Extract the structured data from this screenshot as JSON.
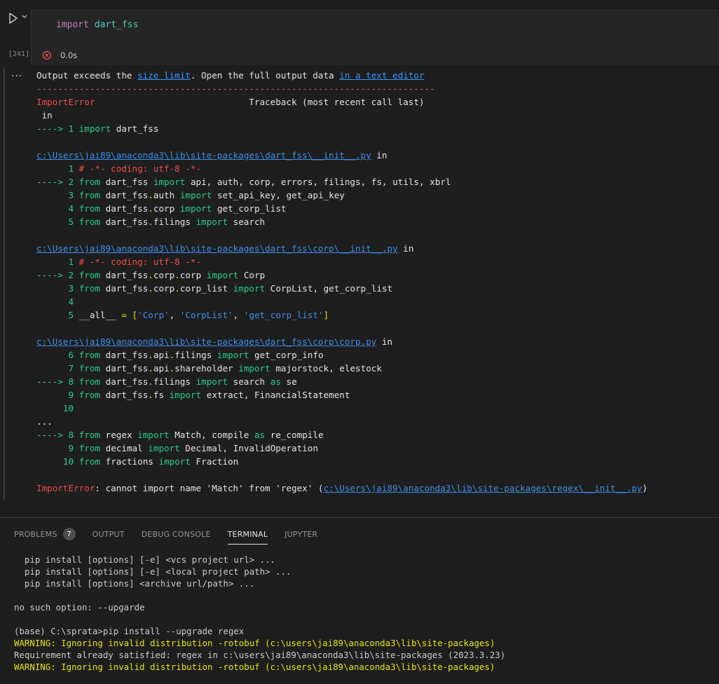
{
  "cell": {
    "execution_count": "[241]",
    "code": {
      "keyword": "import",
      "module": "dart_fss"
    },
    "status_time": "0.0s"
  },
  "output": {
    "menu_dots": "...",
    "notice": {
      "prefix": "Output exceeds the ",
      "link1": "size limit",
      "middle": ". Open the full output data ",
      "link2": "in a text editor"
    },
    "dashes": "---------------------------------------------------------------------------",
    "error_name": "ImportError",
    "traceback_label": "Traceback (most recent call last)",
    "in_label": " in",
    "arrow": "---->",
    "first": {
      "num": "1",
      "kw": "import",
      "rest": " dart_fss"
    },
    "blocks": [
      {
        "path": "c:\\Users\\jai89\\anaconda3\\lib\\site-packages\\dart_fss\\__init__.py",
        "suffix": " in",
        "lines": [
          {
            "prefix": "      ",
            "num": "1",
            "comment": " # -*- coding: utf-8 -*-"
          },
          {
            "prefix": "----> ",
            "num": "2",
            "from": "dart_fss",
            "imp": "api, auth, corp, errors, filings, fs, utils, xbrl"
          },
          {
            "prefix": "      ",
            "num": "3",
            "from": "dart_fss.auth",
            "imp": "set_api_key, get_api_key"
          },
          {
            "prefix": "      ",
            "num": "4",
            "from": "dart_fss.corp",
            "imp": "get_corp_list"
          },
          {
            "prefix": "      ",
            "num": "5",
            "from": "dart_fss.filings",
            "imp": "search"
          }
        ]
      },
      {
        "path": "c:\\Users\\jai89\\anaconda3\\lib\\site-packages\\dart_fss\\corp\\__init__.py",
        "suffix": " in",
        "lines": [
          {
            "prefix": "      ",
            "num": "1",
            "comment": " # -*- coding: utf-8 -*-"
          },
          {
            "prefix": "----> ",
            "num": "2",
            "from": "dart_fss.corp.corp",
            "imp": "Corp"
          },
          {
            "prefix": "      ",
            "num": "3",
            "from": "dart_fss.corp.corp_list",
            "imp": "CorpList, get_corp_list"
          },
          {
            "prefix": "      ",
            "num": "4"
          },
          {
            "prefix": "      ",
            "num": "5",
            "all": {
              "name": " __all__ ",
              "eq": "=",
              "open": " [",
              "items": [
                "'Corp'",
                "'CorpList'",
                "'get_corp_list'"
              ],
              "close": "]"
            }
          }
        ]
      },
      {
        "path": "c:\\Users\\jai89\\anaconda3\\lib\\site-packages\\dart_fss\\corp\\corp.py",
        "suffix": " in",
        "lines": [
          {
            "prefix": "      ",
            "num": "6",
            "from": "dart_fss.api.filings",
            "imp": "get_corp_info"
          },
          {
            "prefix": "      ",
            "num": "7",
            "from": "dart_fss.api.shareholder",
            "imp": "majorstock, elestock"
          },
          {
            "prefix": "----> ",
            "num": "8",
            "from": "dart_fss.filings",
            "imp": "search",
            "as": "se"
          },
          {
            "prefix": "      ",
            "num": "9",
            "from": "dart_fss.fs",
            "imp": "extract, FinancialStatement"
          },
          {
            "prefix": "     ",
            "num": "10"
          }
        ]
      }
    ],
    "ellipsis": "...",
    "last_block": [
      {
        "prefix": "----> ",
        "num": "8",
        "from": "regex",
        "imp": "Match, compile",
        "as": "re_compile"
      },
      {
        "prefix": "      ",
        "num": "9",
        "from": "decimal",
        "imp": "Decimal, InvalidOperation"
      },
      {
        "prefix": "     ",
        "num": "10",
        "from": "fractions",
        "imp": "Fraction"
      }
    ],
    "final": {
      "name": "ImportError",
      "message": ": cannot import name 'Match' from 'regex' (",
      "path": "c:\\Users\\jai89\\anaconda3\\lib\\site-packages\\regex\\__init__.py",
      "close": ")"
    },
    "kw_from": "from",
    "kw_import": "import",
    "kw_as": "as"
  },
  "panel": {
    "tabs": [
      {
        "label": "PROBLEMS",
        "badge": "7"
      },
      {
        "label": "OUTPUT"
      },
      {
        "label": "DEBUG CONSOLE"
      },
      {
        "label": "TERMINAL",
        "active": true
      },
      {
        "label": "JUPYTER"
      }
    ],
    "terminal_lines": [
      {
        "text": "  pip install [options] [-e] <vcs project url> ..."
      },
      {
        "text": "  pip install [options] [-e] <local project path> ..."
      },
      {
        "text": "  pip install [options] <archive url/path> ..."
      },
      {
        "text": ""
      },
      {
        "text": "no such option: --upgarde"
      },
      {
        "text": ""
      },
      {
        "text": "(base) C:\\sprata>pip install --upgrade regex"
      },
      {
        "text": "WARNING: Ignoring invalid distribution -rotobuf (c:\\users\\jai89\\anaconda3\\lib\\site-packages)",
        "warn": true
      },
      {
        "text": "Requirement already satisfied: regex in c:\\users\\jai89\\anaconda3\\lib\\site-packages (2023.3.23)"
      },
      {
        "text": "WARNING: Ignoring invalid distribution -rotobuf (c:\\users\\jai89\\anaconda3\\lib\\site-packages)",
        "warn": true
      }
    ]
  }
}
